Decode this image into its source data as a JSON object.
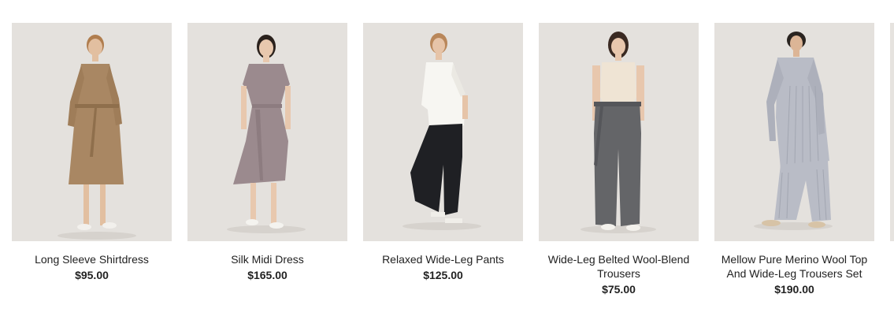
{
  "products": [
    {
      "name": "Long Sleeve Shirtdress",
      "price": "$95.00"
    },
    {
      "name": "Silk Midi Dress",
      "price": "$165.00"
    },
    {
      "name": "Relaxed Wide-Leg Pants",
      "price": "$125.00"
    },
    {
      "name": "Wide-Leg Belted Wool-Blend Trousers",
      "price": "$75.00"
    },
    {
      "name": "Mellow Pure Merino Wool Top And Wide-Leg Trousers Set",
      "price": "$190.00"
    }
  ],
  "colors": {
    "photo_background": "#e4e1dd",
    "shirtdress": "#a98763",
    "silk_dress": "#9b8a8e",
    "pants_top": "#f7f6f2",
    "pants_bottom": "#1f2024",
    "trousers_top": "#efe4d4",
    "trousers_bottom": "#646568",
    "merino_set": "#b9bcc6"
  }
}
